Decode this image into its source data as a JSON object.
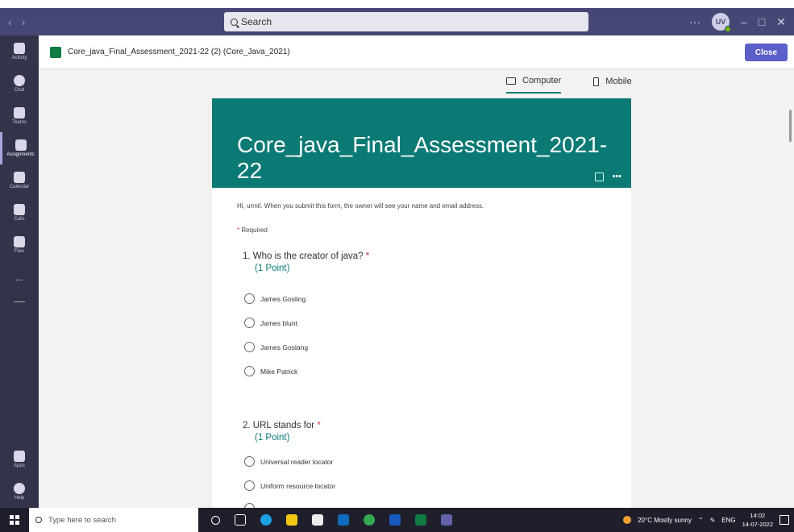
{
  "titlebar": {
    "search_placeholder": "Search",
    "avatar_initials": "UV"
  },
  "rail": {
    "items": [
      {
        "label": "Activity",
        "icon": "bell-icon"
      },
      {
        "label": "Chat",
        "icon": "chat-icon"
      },
      {
        "label": "Teams",
        "icon": "teams-icon"
      },
      {
        "label": "Assignments",
        "icon": "assignments-icon"
      },
      {
        "label": "Calendar",
        "icon": "calendar-icon"
      },
      {
        "label": "Calls",
        "icon": "phone-icon"
      },
      {
        "label": "Files",
        "icon": "file-icon"
      }
    ],
    "more_label": "...",
    "bottom": [
      {
        "label": "Apps",
        "icon": "apps-icon"
      },
      {
        "label": "Help",
        "icon": "help-icon"
      }
    ]
  },
  "header": {
    "file_name": "Core_java_Final_Assessment_2021-22 (2) (Core_Java_2021)",
    "close_label": "Close"
  },
  "view_tabs": {
    "computer": "Computer",
    "mobile": "Mobile"
  },
  "form": {
    "title": "Core_java_Final_Assessment_2021-22",
    "intro": "Hi, urmil. When you submit this form, the owner will see your name and email address.",
    "required_star": "*",
    "required_text": "Required",
    "questions": [
      {
        "title": "1. Who is the creator of java?",
        "points": "(1 Point)",
        "options": [
          "James Gosling",
          "James blunt",
          "James Goslang",
          "Mike Patrick"
        ]
      },
      {
        "title": "2. URL stands for",
        "points": "(1 Point)",
        "options": [
          "Universal reader locator",
          "Uniform resource locator"
        ]
      }
    ]
  },
  "taskbar": {
    "search_placeholder": "Type here to search",
    "weather": "20°C  Mostly sunny",
    "lang": "ENG",
    "time": "14:02",
    "date": "14-07-2022"
  }
}
